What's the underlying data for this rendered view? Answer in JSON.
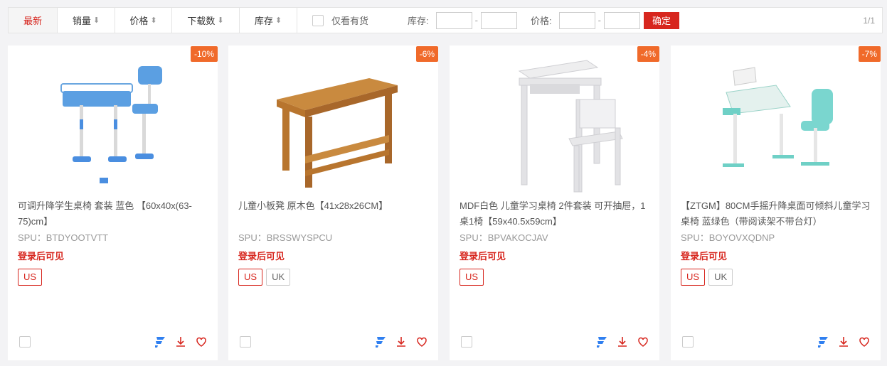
{
  "toolbar": {
    "sorts": [
      {
        "label": "最新",
        "arrow": ""
      },
      {
        "label": "销量",
        "arrow": "⬇"
      },
      {
        "label": "价格",
        "arrow": "⬍"
      },
      {
        "label": "下载数",
        "arrow": "⬇"
      },
      {
        "label": "库存",
        "arrow": "⬍"
      }
    ],
    "instock_label": "仅看有货",
    "stock_label": "库存:",
    "price_label": "价格:",
    "dash": "-",
    "confirm_label": "确定",
    "pager": "1/1"
  },
  "products": [
    {
      "discount": "-10%",
      "title": "可调升降学生桌椅 套装 蓝色 【60x40x(63-75)cm】",
      "spu": "SPU：BTDYOOTVTT",
      "login": "登录后可见",
      "tags": [
        "US"
      ]
    },
    {
      "discount": "-6%",
      "title": "儿童小板凳 原木色【41x28x26CM】",
      "spu": "SPU：BRSSWYSPCU",
      "login": "登录后可见",
      "tags": [
        "US",
        "UK"
      ]
    },
    {
      "discount": "-4%",
      "title": "MDF白色 儿童学习桌椅 2件套装 可开抽屉，1桌1椅【59x40.5x59cm】",
      "spu": "SPU：BPVAKOCJAV",
      "login": "登录后可见",
      "tags": [
        "US"
      ]
    },
    {
      "discount": "-7%",
      "title": "【ZTGM】80CM手摇升降桌面可倾斜儿童学习桌椅 蓝绿色（带阅读架不带台灯）",
      "spu": "SPU：BOYOVXQDNP",
      "login": "登录后可见",
      "tags": [
        "US",
        "UK"
      ]
    }
  ],
  "colors": {
    "accent": "#d7261e",
    "badge": "#f06a2a",
    "brand_icon": "#2f7ff0"
  },
  "icons": [
    "store-icon",
    "download-icon",
    "heart-icon"
  ]
}
